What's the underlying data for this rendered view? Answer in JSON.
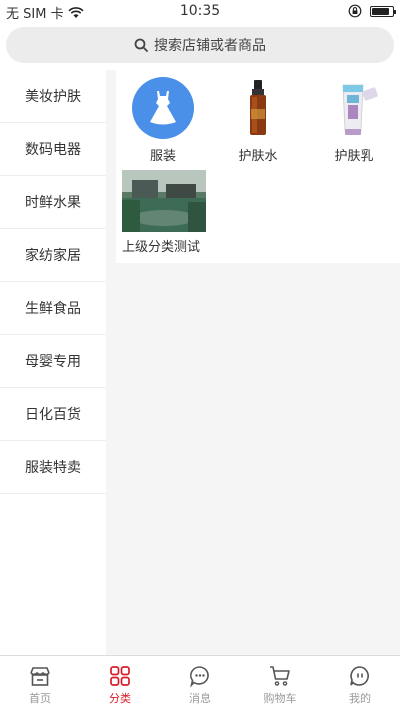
{
  "status": {
    "carrier": "无 SIM 卡",
    "time": "10:35"
  },
  "search": {
    "placeholder": "搜索店铺或者商品",
    "icon": "search-icon"
  },
  "sidebar": {
    "items": [
      {
        "label": "美妆护肤"
      },
      {
        "label": "数码电器"
      },
      {
        "label": "时鲜水果"
      },
      {
        "label": "家纺家居"
      },
      {
        "label": "生鲜食品"
      },
      {
        "label": "母婴专用"
      },
      {
        "label": "日化百货"
      },
      {
        "label": "服装特卖"
      }
    ]
  },
  "categories": [
    {
      "label": "服装",
      "icon": "dress-icon"
    },
    {
      "label": "护肤水",
      "icon": "serum-bottle-image"
    },
    {
      "label": "护肤乳",
      "icon": "lotion-tube-image"
    },
    {
      "label": "上级分类测试",
      "icon": "garden-photo"
    }
  ],
  "tabbar": {
    "items": [
      {
        "label": "首页",
        "icon": "store-icon"
      },
      {
        "label": "分类",
        "icon": "grid-icon"
      },
      {
        "label": "消息",
        "icon": "chat-icon"
      },
      {
        "label": "购物车",
        "icon": "cart-icon"
      },
      {
        "label": "我的",
        "icon": "profile-icon"
      }
    ],
    "active_index": 1
  },
  "colors": {
    "accent": "#d81e2a",
    "dress_bg": "#4a8fe8",
    "inactive": "#999999"
  }
}
